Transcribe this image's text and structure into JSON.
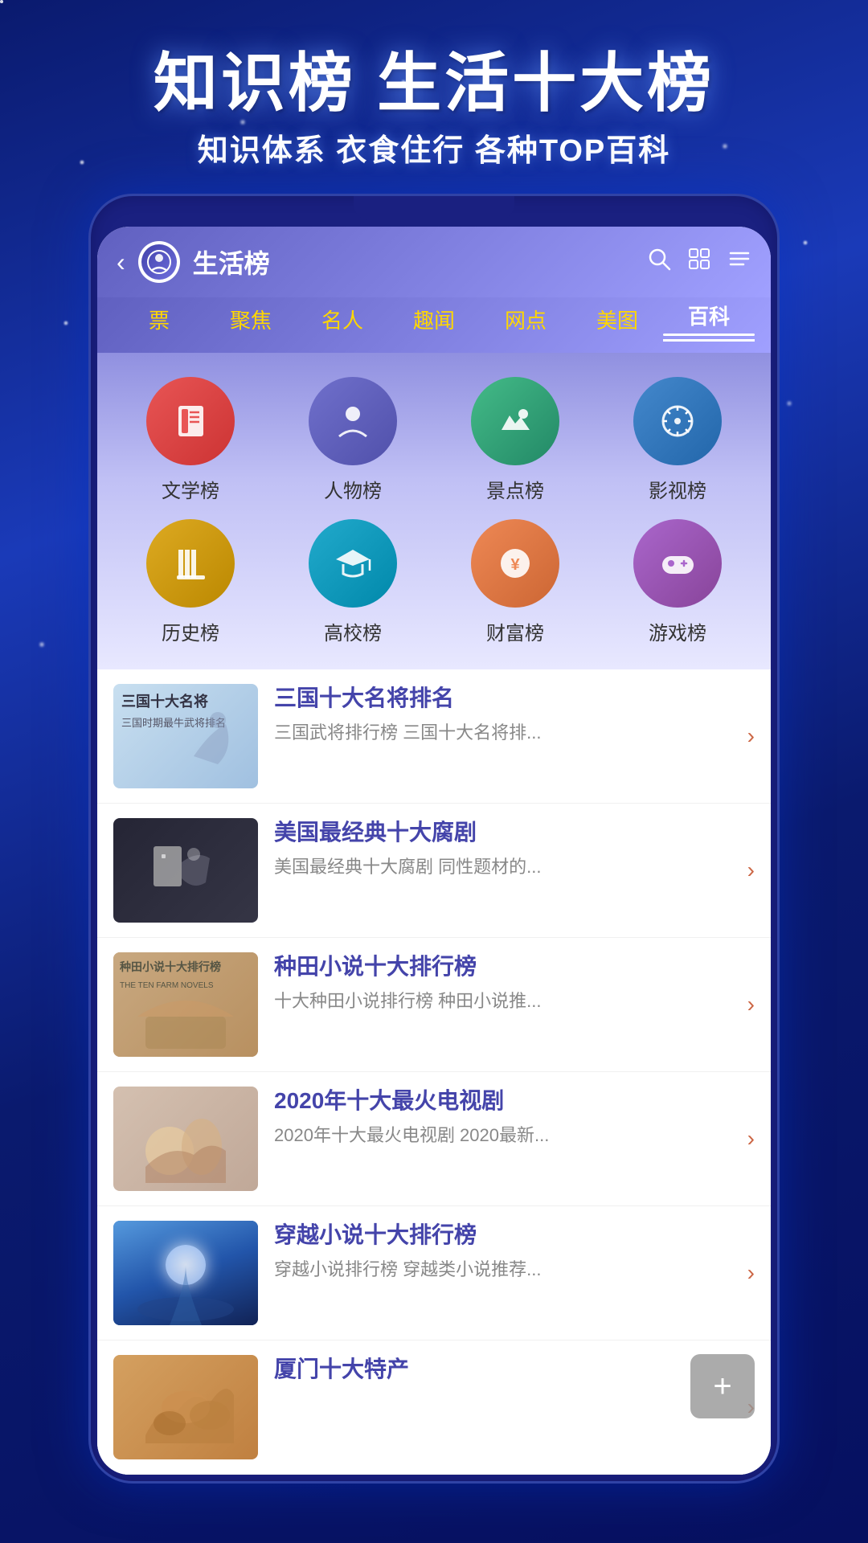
{
  "background": {
    "header_title": "知识榜 生活十大榜",
    "header_subtitle": "知识体系 衣食住行 各种TOP百科"
  },
  "nav": {
    "back_label": "‹",
    "title": "生活榜",
    "search_icon": "search",
    "grid_icon": "grid",
    "list_icon": "list"
  },
  "tabs": [
    {
      "label": "票",
      "active": false
    },
    {
      "label": "聚焦",
      "active": false
    },
    {
      "label": "名人",
      "active": false
    },
    {
      "label": "趣闻",
      "active": false
    },
    {
      "label": "网点",
      "active": false
    },
    {
      "label": "美图",
      "active": false
    },
    {
      "label": "百科",
      "active": true
    }
  ],
  "categories": [
    {
      "id": "wenxue",
      "label": "文学榜",
      "icon": "📖",
      "color_class": "icon-wenxue"
    },
    {
      "id": "renwu",
      "label": "人物榜",
      "icon": "👤",
      "color_class": "icon-renwu"
    },
    {
      "id": "jingdian",
      "label": "景点榜",
      "icon": "🏔",
      "color_class": "icon-jingdian"
    },
    {
      "id": "yingshi",
      "label": "影视榜",
      "icon": "🎬",
      "color_class": "icon-yingshi"
    },
    {
      "id": "lishi",
      "label": "历史榜",
      "icon": "📜",
      "color_class": "icon-lishi"
    },
    {
      "id": "gaoxiao",
      "label": "高校榜",
      "icon": "🎓",
      "color_class": "icon-gaoxiao"
    },
    {
      "id": "caifu",
      "label": "财富榜",
      "icon": "💰",
      "color_class": "icon-caifu"
    },
    {
      "id": "youxi",
      "label": "游戏榜",
      "icon": "🎮",
      "color_class": "icon-youxi"
    }
  ],
  "list_items": [
    {
      "id": "item1",
      "thumb_class": "thumb-sanguozhi",
      "thumb_text": "三国十大名将\n三国时期最牛武将排名",
      "title": "三国十大名将排名",
      "desc": "三国武将排行榜 三国十大名将排..."
    },
    {
      "id": "item2",
      "thumb_class": "thumb-meiguo",
      "thumb_text": "",
      "title": "美国最经典十大腐剧",
      "desc": "美国最经典十大腐剧 同性题材的..."
    },
    {
      "id": "item3",
      "thumb_class": "thumb-zhongtian",
      "thumb_text": "种田小说十大排行榜\nTHE TEN FARM NOVELS",
      "title": "种田小说十大排行榜",
      "desc": "十大种田小说排行榜 种田小说推..."
    },
    {
      "id": "item4",
      "thumb_class": "thumb-2020",
      "thumb_text": "",
      "title": "2020年十大最火电视剧",
      "desc": "2020年十大最火电视剧 2020最新..."
    },
    {
      "id": "item5",
      "thumb_class": "thumb-chuanyue",
      "thumb_text": "",
      "title": "穿越小说十大排行榜",
      "desc": "穿越小说排行榜 穿越类小说推荐..."
    },
    {
      "id": "item6",
      "thumb_class": "thumb-xiamen",
      "thumb_text": "",
      "title": "厦门十大特产",
      "desc": ""
    }
  ],
  "float_btn": {
    "label": "+"
  }
}
